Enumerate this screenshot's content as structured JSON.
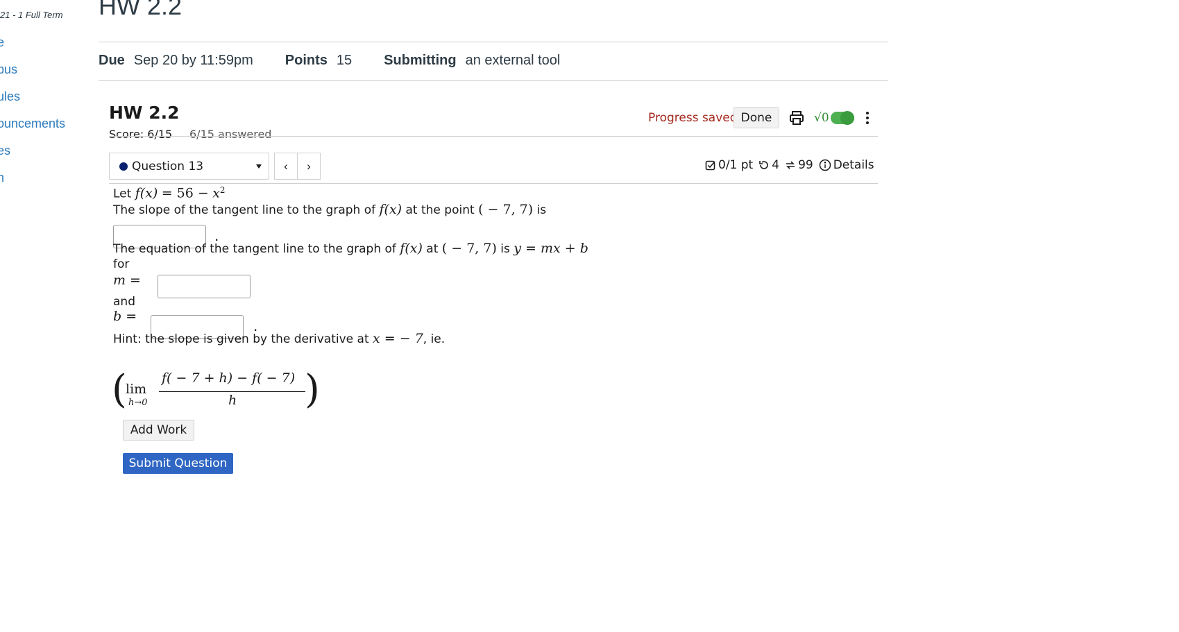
{
  "sidebar": {
    "term": "21 - 1 Full Term",
    "items": [
      {
        "label": "e"
      },
      {
        "label": "bus"
      },
      {
        "label": "ules"
      },
      {
        "label": "ouncements"
      },
      {
        "label": "es"
      },
      {
        "label": "n"
      }
    ]
  },
  "header": {
    "title": "HW 2.2",
    "due_label": "Due",
    "due_value": "Sep 20 by 11:59pm",
    "points_label": "Points",
    "points_value": "15",
    "submitting_label": "Submitting",
    "submitting_value": "an external tool"
  },
  "tool": {
    "title": "HW 2.2",
    "score": "Score: 6/15",
    "answered": "6/15 answered",
    "progress_status": "Progress saved",
    "done_label": "Done",
    "sqrt_glyph": "√0",
    "question_select": "Question 13",
    "prev_glyph": "‹",
    "next_glyph": "›",
    "stats": {
      "points": "0/1 pt",
      "retries": "4",
      "attempts": "99",
      "details": "Details"
    },
    "colors": {
      "progress": "#a52a1e",
      "submit": "#2f66c4",
      "toggle": "#4caf50",
      "dot": "#0a1f6e"
    }
  },
  "question": {
    "let_text": "Let",
    "f_of_x": "f(x)",
    "equals_56": "= 56 −",
    "x": "x",
    "exp": "2",
    "slope_text": "The slope of the tangent line to the graph of",
    "at_the_point": "at the point",
    "point": "( − 7, 7)",
    "is": "is",
    "period": ".",
    "equation_text": "The equation of the tangent line to the graph of",
    "at": "at",
    "is2": "is",
    "y_eq": "y = mx + b",
    "for": "for",
    "m_eq": "m =",
    "and": "and",
    "b_eq": "b =",
    "hint_text": "Hint: the slope is given by the derivative at",
    "x_eq": "x = − 7",
    "ie": ", ie.",
    "lim": "lim",
    "lim_sub": "h→0",
    "numerator": "f( − 7 + h) − f( − 7)",
    "denominator": "h",
    "add_work": "Add Work",
    "submit": "Submit Question"
  }
}
